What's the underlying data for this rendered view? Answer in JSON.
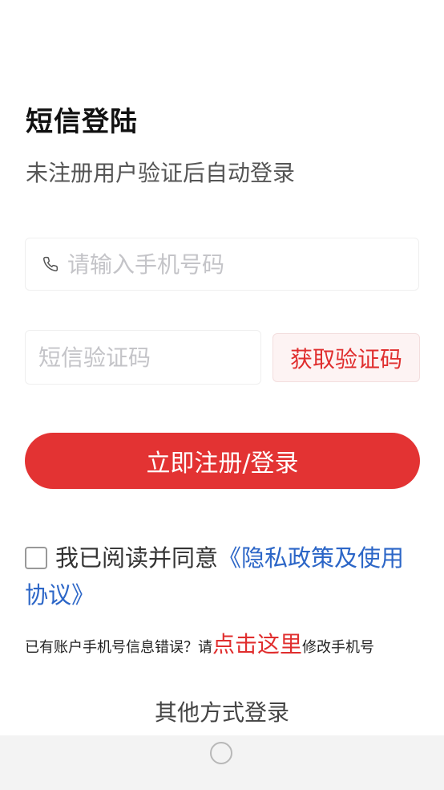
{
  "header": {
    "title": "短信登陆",
    "subtitle": "未注册用户验证后自动登录"
  },
  "form": {
    "phone_placeholder": "请输入手机号码",
    "phone_icon": "phone-icon",
    "code_placeholder": "短信验证码",
    "get_code_label": "获取验证码",
    "submit_label": "立即注册/登录"
  },
  "agreement": {
    "prefix": "我已阅读并同意",
    "link_label": "《隐私政策及使用协议》",
    "checked": false
  },
  "fix_phone": {
    "prefix": "已有账户手机号信息错误？请",
    "link_label": "点击这里",
    "suffix": "修改手机号"
  },
  "other": {
    "label": "其他方式登录"
  },
  "colors": {
    "accent": "#e33333",
    "link": "#2c66c7"
  }
}
